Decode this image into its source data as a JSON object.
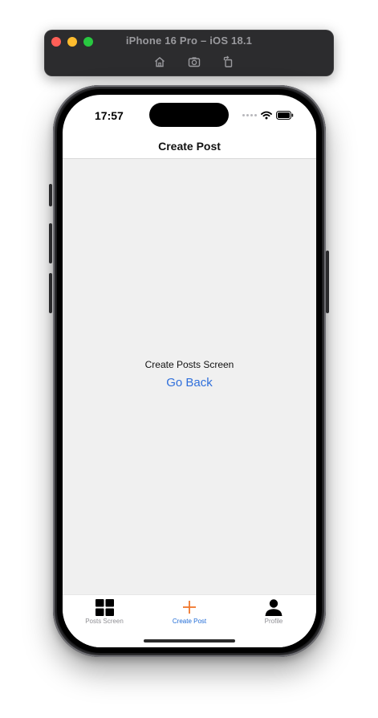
{
  "simulator": {
    "title": "iPhone 16 Pro – iOS 18.1",
    "tools": [
      "home-icon",
      "screenshot-icon",
      "rotate-icon"
    ]
  },
  "status_bar": {
    "time": "17:57"
  },
  "nav": {
    "title": "Create Post"
  },
  "content": {
    "heading": "Create Posts Screen",
    "go_back_label": "Go Back"
  },
  "tab_bar": {
    "tabs": [
      {
        "label": "Posts Screen",
        "icon": "grid-icon",
        "active": false
      },
      {
        "label": "Create Post",
        "icon": "plus-icon",
        "active": true
      },
      {
        "label": "Profile",
        "icon": "person-icon",
        "active": false
      }
    ]
  },
  "colors": {
    "link_blue": "#2f6fdb",
    "active_tab_label": "#1f6bd6",
    "active_tab_icon": "#f0772b",
    "content_background": "#f0f0f0"
  }
}
